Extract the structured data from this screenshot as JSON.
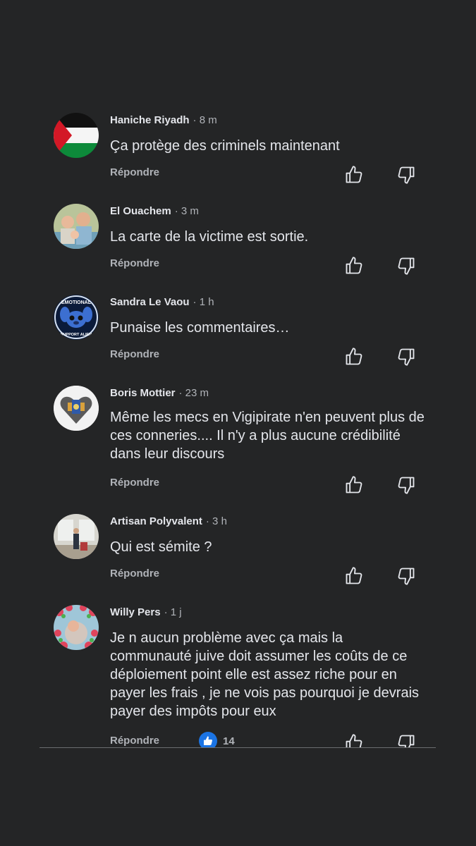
{
  "comments": [
    {
      "author": "Haniche Riyadh",
      "time": "· 8 m",
      "text": "Ça protège des criminels maintenant",
      "reply": "Répondre"
    },
    {
      "author": "El Ouachem",
      "time": "· 3 m",
      "text": "La carte de la victime est sortie.",
      "reply": "Répondre"
    },
    {
      "author": "Sandra Le Vaou",
      "time": "· 1 h",
      "text": "Punaise les commentaires…",
      "reply": "Répondre",
      "avatar_text_top": "EMOTIONAL",
      "avatar_text_bottom": "SUPPORT ALIEN"
    },
    {
      "author": "Boris Mottier",
      "time": "· 23 m",
      "text": "Même les mecs en Vigipirate n'en peuvent plus de ces conneries.... Il n'y a plus aucune crédibilité dans leur discours",
      "reply": "Répondre"
    },
    {
      "author": "Artisan Polyvalent",
      "time": "· 3 h",
      "text": "Qui est sémite ?",
      "reply": "Répondre"
    },
    {
      "author": "Willy Pers",
      "time": "· 1 j",
      "text": "Je n aucun problème avec ça  mais la communauté juive doit assumer les coûts de ce déploiement point elle est assez riche pour en payer les frais  , je ne vois pas pourquoi je devrais payer des impôts pour eux",
      "reply": "Répondre",
      "reaction_count": "14",
      "reaction_icon": "like-icon"
    }
  ],
  "icons": {
    "up": "thumbs-up-icon",
    "down": "thumbs-down-icon"
  },
  "colors": {
    "background": "#242526",
    "text": "#e4e6eb",
    "muted": "#b0b3b8",
    "like": "#1b74e4"
  }
}
